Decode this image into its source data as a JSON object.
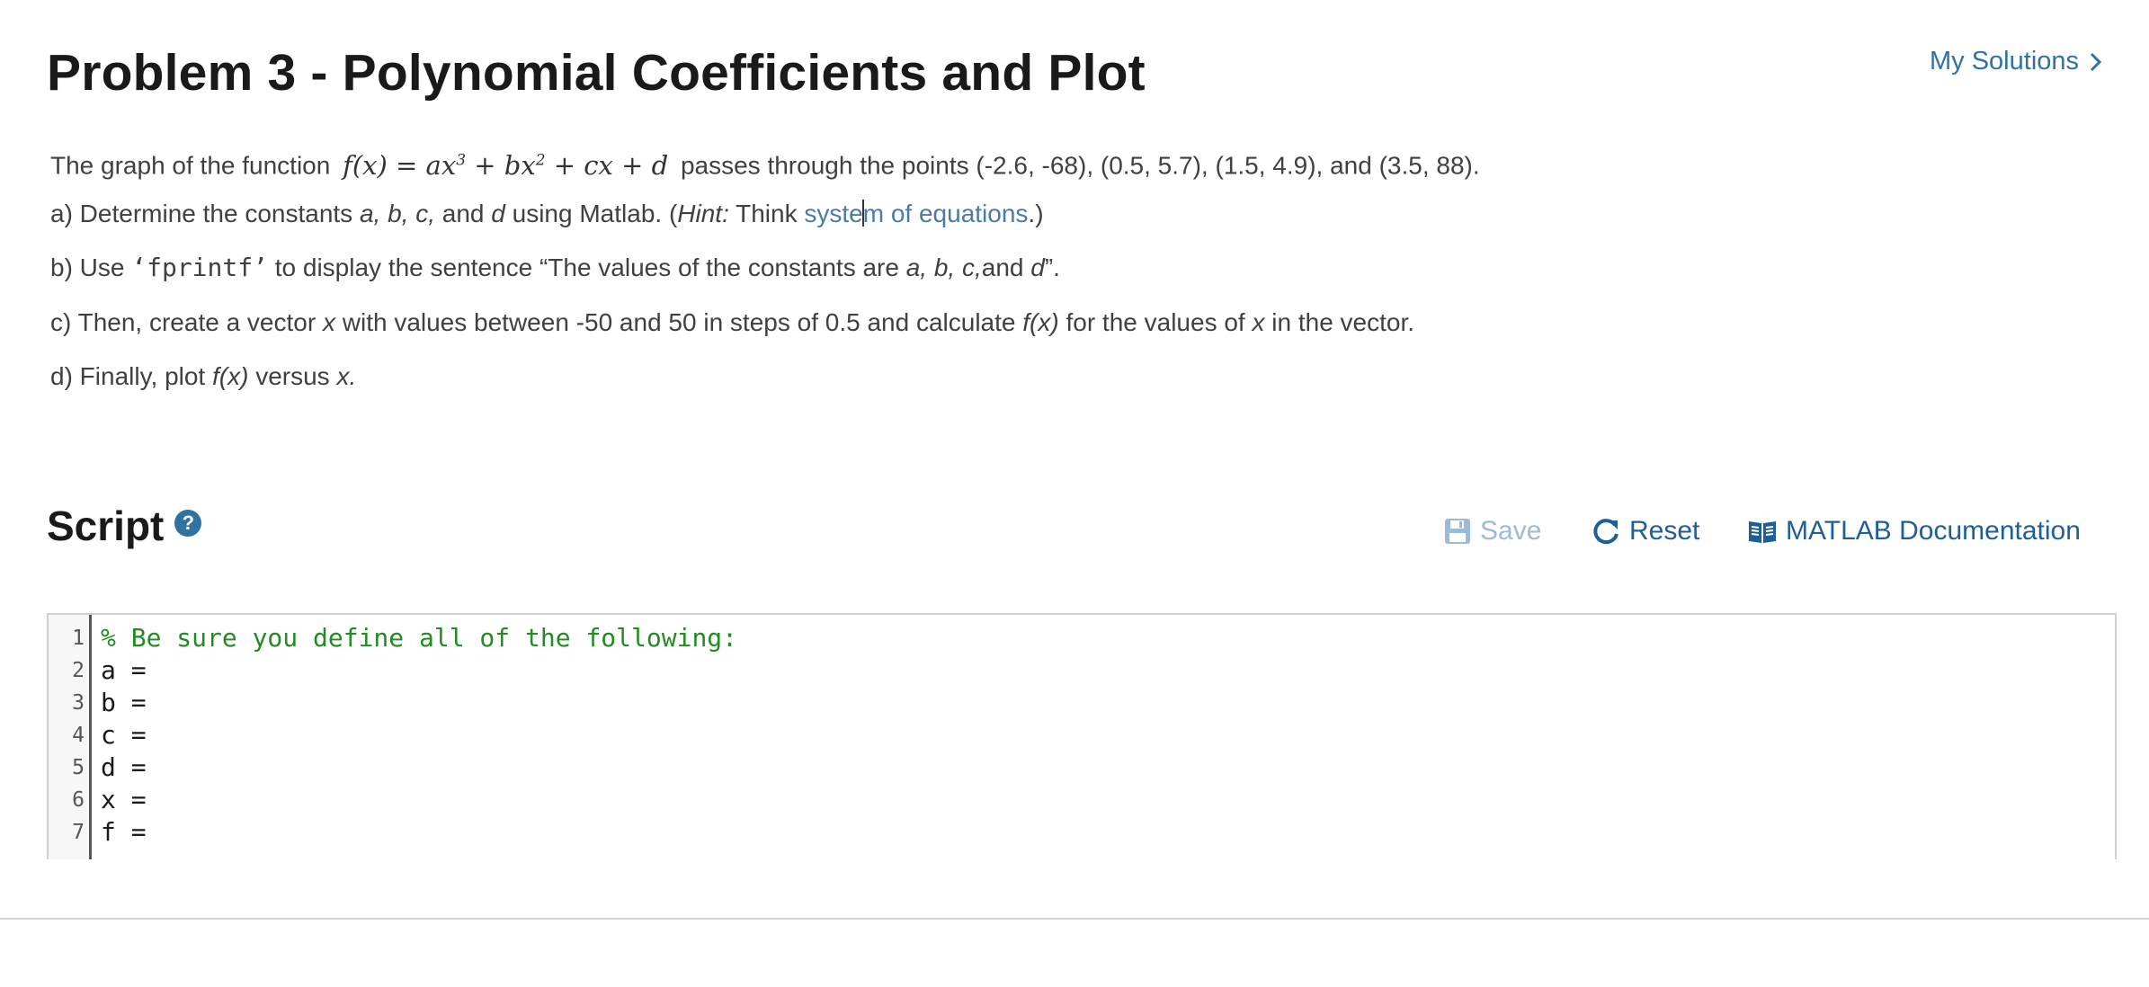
{
  "header": {
    "title": "Problem 3 - Polynomial Coefficients and Plot",
    "my_solutions_label": "My Solutions"
  },
  "problem": {
    "intro_before": "The graph of the function",
    "function_lhs": "f(x) = ax",
    "function_mid1": " + bx",
    "function_tail": " + cx + d",
    "exp3": "3",
    "exp2": "2",
    "intro_after": "passes through the points (-2.6, -68), (0.5, 5.7), (1.5, 4.9), and (3.5, 88).",
    "a_prefix": "a)  Determine the constants ",
    "a_vars": "a, b, c,",
    "a_and": " and ",
    "a_d": "d",
    "a_mid": " using Matlab. (",
    "a_hint": "Hint:",
    "a_think": " Think ",
    "a_link": "system of equations",
    "a_suffix": ".)",
    "b_prefix": "b)  Use ",
    "b_code": "‘fprintf’",
    "b_mid": " to display the sentence “The values of the constants are ",
    "b_vars": "a, b, c,",
    "b_and": "and ",
    "b_d": "d",
    "b_suffix": "”.",
    "c_prefix": "c)  Then, create a vector ",
    "c_x": "x",
    "c_mid": " with values between -50 and 50 in steps of 0.5 and calculate ",
    "c_fx": "f(x)",
    "c_mid2": " for the values of ",
    "c_x2": "x",
    "c_suffix": " in the vector.",
    "d_prefix": "d)  Finally, plot ",
    "d_fx": "f(x)",
    "d_mid": " versus ",
    "d_x": "x."
  },
  "script": {
    "title": "Script",
    "help_icon": "question-circle-icon",
    "save_label": "Save",
    "reset_label": "Reset",
    "docs_label": "MATLAB Documentation",
    "accent_color": "#1f5f99",
    "disabled_color": "#9dbbd6"
  },
  "editor": {
    "lines": [
      {
        "n": "1",
        "text": "% Be sure you define all of the following:"
      },
      {
        "n": "2",
        "text": "a ="
      },
      {
        "n": "3",
        "text": "b ="
      },
      {
        "n": "4",
        "text": "c ="
      },
      {
        "n": "5",
        "text": "d ="
      },
      {
        "n": "6",
        "text": "x ="
      },
      {
        "n": "7",
        "text": "f ="
      }
    ]
  }
}
